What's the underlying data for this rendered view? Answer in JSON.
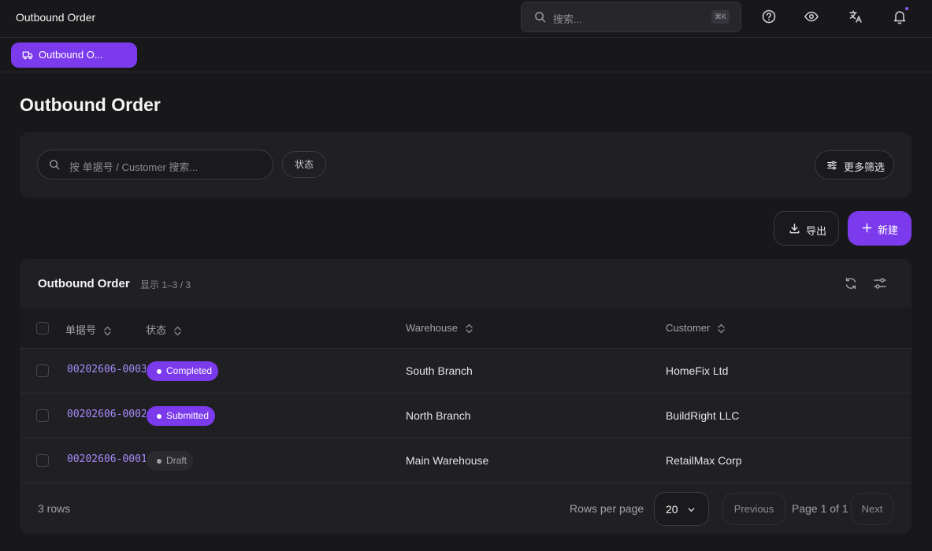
{
  "header": {
    "app_title": "Outbound Order",
    "search_placeholder": "搜索...",
    "search_shortcut": "⌘K",
    "icons": [
      "help-icon",
      "eye-icon",
      "translate-icon",
      "bell-icon"
    ]
  },
  "tabs": [
    {
      "label": "Outbound O...",
      "icon": "truck-icon",
      "active": true
    }
  ],
  "page": {
    "title": "Outbound Order"
  },
  "filters": {
    "search_placeholder": "按 单据号 / Customer 搜索...",
    "status_label": "状态",
    "more_filters_label": "更多筛选"
  },
  "actions": {
    "export_label": "导出",
    "new_label": "新建"
  },
  "table": {
    "title": "Outbound Order",
    "count_text": "显示 1–3 / 3",
    "columns": [
      "单据号",
      "状态",
      "Warehouse",
      "Customer"
    ],
    "rows": [
      {
        "order_no": "00202606-0003",
        "status": "Completed",
        "warehouse": "South Branch",
        "customer": "HomeFix Ltd"
      },
      {
        "order_no": "00202606-0002",
        "status": "Submitted",
        "warehouse": "North Branch",
        "customer": "BuildRight LLC"
      },
      {
        "order_no": "00202606-0001",
        "status": "Draft",
        "warehouse": "Main Warehouse",
        "customer": "RetailMax Corp"
      }
    ]
  },
  "footer": {
    "rows_text": "3 rows",
    "rows_per_page_label": "Rows per page",
    "rows_per_page_value": "20",
    "prev_label": "Previous",
    "page_info": "Page 1 of 1",
    "next_label": "Next"
  },
  "colors": {
    "accent": "#7c3aed",
    "link": "#a78bfa",
    "background": "#18181b",
    "card": "#202024"
  }
}
